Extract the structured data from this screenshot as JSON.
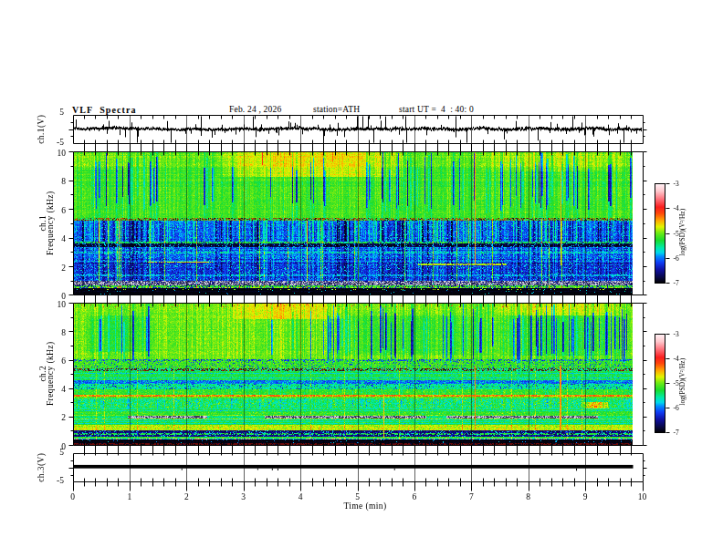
{
  "header": {
    "title": "VLF  Spectra",
    "date": "Feb. 24 , 2026",
    "station": "station=ATH",
    "start_ut": "start UT =  4  : 40: 0"
  },
  "axes": {
    "x_label": "Time (min)",
    "x_ticks": [
      "0",
      "1",
      "2",
      "3",
      "4",
      "5",
      "6",
      "7",
      "8",
      "9",
      "10"
    ],
    "wave_y_ticks": [
      "5",
      "-5"
    ],
    "spec_y_ticks": [
      "10",
      "8",
      "6",
      "4",
      "2",
      "0"
    ],
    "ch3_y_ticks": [
      "5",
      "-5"
    ],
    "ch1_wave_label": "ch.1(V)",
    "ch1_spec_label_line1": "ch.1",
    "ch1_spec_label_line2": "Frequency (kHz)",
    "ch2_spec_label_line1": "ch.2",
    "ch2_spec_label_line2": "Frequency (kHz)",
    "ch3_label": "ch.3(V)"
  },
  "colorbar": {
    "label": "log(PSD)(V²/Hz)",
    "ticks": [
      "-3",
      "-4",
      "-5",
      "-6",
      "-7"
    ],
    "vmin": -7,
    "vmax": -3,
    "stops": [
      [
        0.0,
        2,
        2,
        10
      ],
      [
        0.05,
        8,
        8,
        70
      ],
      [
        0.125,
        15,
        15,
        160
      ],
      [
        0.2,
        15,
        60,
        245
      ],
      [
        0.262,
        0,
        140,
        255
      ],
      [
        0.3,
        0,
        215,
        235
      ],
      [
        0.35,
        0,
        235,
        170
      ],
      [
        0.425,
        25,
        220,
        45
      ],
      [
        0.5,
        110,
        235,
        20
      ],
      [
        0.562,
        225,
        245,
        0
      ],
      [
        0.625,
        255,
        170,
        0
      ],
      [
        0.7,
        255,
        70,
        10
      ],
      [
        0.762,
        250,
        30,
        30
      ],
      [
        0.85,
        255,
        120,
        130
      ],
      [
        0.925,
        255,
        200,
        205
      ],
      [
        1.0,
        255,
        242,
        246
      ]
    ]
  },
  "chart_data": [
    {
      "id": "ch1-waveform",
      "type": "line",
      "ylabel": "ch.1(V)",
      "ylim": [
        -5,
        5
      ],
      "xlim_min": [
        0,
        10
      ],
      "description": "broadband noise trace near 0 V with impulsive spikes",
      "noise_amp": 1.0,
      "spike_prob": 0.1,
      "big_spike_prob": 0.022,
      "seed": 101
    },
    {
      "id": "ch1-spectrogram",
      "type": "heatmap",
      "ylabel": "Frequency (kHz)",
      "ylim": [
        0,
        10
      ],
      "xlim_min": [
        0,
        10
      ],
      "zlabel": "log(PSD)(V²/Hz)",
      "zlim": [
        -7,
        -3
      ],
      "seed": 777,
      "rowsig": 0.07,
      "bands": [
        {
          "f0": 9.0,
          "f1": 10.01,
          "v": -5.1,
          "sig": 0.18,
          "stripe": "hi",
          "gain": 1.0
        },
        {
          "f0": 5.4,
          "f1": 9.0,
          "v": -5.2,
          "sig": 0.17,
          "stripe": "hi",
          "gain": 1.0
        },
        {
          "f0": 5.2,
          "f1": 5.4,
          "v": -5.35,
          "sig": 0.3,
          "stripe": "hi",
          "gain": 0.5,
          "mixP": 0.5,
          "mix": [
            [
              0.5,
              150,
              70,
              10
            ],
            [
              0.3,
              30,
              30,
              20
            ],
            [
              0.2,
              200,
              110,
              0
            ]
          ]
        },
        {
          "f0": 3.7,
          "f1": 5.2,
          "v": -6.1,
          "sig": 0.28,
          "stripe": "lo",
          "gain": 1.05,
          "spkP": 0.08,
          "spkV": -5.65,
          "rowGain": 2.0
        },
        {
          "f0": 3.55,
          "f1": 3.7,
          "v": -5.4,
          "sig": 0.25,
          "stripe": "lo",
          "gain": 0.4,
          "spkP": 0.2,
          "spkV": -6.5
        },
        {
          "f0": 3.3,
          "f1": 3.55,
          "v": -6.85,
          "sig": 0.15,
          "stripe": "lo",
          "gain": 0.3,
          "spkP": 0.13,
          "spkV": -5.9
        },
        {
          "f0": 2.3,
          "f1": 3.3,
          "v": -6.15,
          "sig": 0.28,
          "stripe": "lo",
          "gain": 0.6,
          "spkP": 0.12,
          "spkV": -5.7,
          "rowGain": 2.0
        },
        {
          "f0": 0.95,
          "f1": 2.3,
          "v": -6.3,
          "sig": 0.28,
          "stripe": "lo",
          "gain": 0.55,
          "spkP": 0.1,
          "spkV": -5.75,
          "rowGain": 2.0
        },
        {
          "f0": 0.6,
          "f1": 0.95,
          "v": -6.6,
          "sig": 0.25,
          "mixP": 0.8,
          "mix": [
            [
              0.42,
              60,
              60,
              95
            ],
            [
              0.34,
              190,
              188,
              205
            ],
            [
              0.14,
              120,
              125,
              175
            ],
            [
              0.1,
              225,
              222,
              232
            ]
          ]
        },
        {
          "f0": 0.5,
          "f1": 0.6,
          "v": -5.2,
          "sig": 0.3,
          "spkP": 0.25,
          "spkV": -6.6
        },
        {
          "f0": 0.4,
          "f1": 0.5,
          "v": -4.95,
          "sig": 0.35,
          "spkP": 0.3,
          "spkV": -6.3
        },
        {
          "f0": 0.0,
          "f1": 0.4,
          "v": -7.0,
          "sig": 0.08,
          "spkP": 0.02,
          "spkV": -5.8
        }
      ],
      "hlines": [
        {
          "f0": 2.2,
          "f1": 2.32,
          "t0": 1.3,
          "t1": 2.45,
          "v": -4.7,
          "sig": 0.25,
          "dash": 0.15
        },
        {
          "f0": 2.05,
          "f1": 2.15,
          "t0": 6.05,
          "t1": 7.6,
          "v": -4.85,
          "sig": 0.2,
          "dash": 0.15
        },
        {
          "f0": 2.9,
          "f1": 3.0,
          "v": -5.65,
          "sig": 0.3,
          "dash": 0.35
        },
        {
          "f0": 1.28,
          "f1": 1.38,
          "v": -5.8,
          "sig": 0.25,
          "dash": 0.35
        },
        {
          "f0": 0.28,
          "f1": 0.34,
          "v": -4.9,
          "sig": 0.3,
          "dash": 0.9
        }
      ],
      "warm": [
        {
          "t0": 2.6,
          "t1": 5.8,
          "f0": 8.3,
          "f1": 10.01,
          "dv": 0.4
        },
        {
          "t0": 7.2,
          "t1": 9.7,
          "f0": 8.7,
          "f1": 10.01,
          "dv": 0.22
        },
        {
          "t0": 0.0,
          "t1": 1.1,
          "f0": 8.8,
          "f1": 10.01,
          "dv": 0.1
        }
      ],
      "events": [
        {
          "t": 7.05,
          "f0": 2.05,
          "f1": 10.01,
          "v": -4.45,
          "w": 1.4
        },
        {
          "t": 8.55,
          "f0": 2.05,
          "f1": 10.01,
          "v": -4.55,
          "w": 1.0
        },
        {
          "t": 3.32,
          "f0": 9.1,
          "f1": 10.01,
          "v": -4.1,
          "w": 1.6
        },
        {
          "t": 4.55,
          "f0": 9.3,
          "f1": 10.01,
          "v": -4.3,
          "w": 1.2
        }
      ],
      "sferics": {
        "n": 26,
        "f0": 0.45,
        "f1": 5.4,
        "dv": 1.0,
        "seed": 55
      },
      "stripes": {
        "hi": {
          "sig": 0.17,
          "pDark": 0.06,
          "dark": [
            0.85,
            1.4
          ],
          "pBright": 0.2,
          "bright": [
            0.08,
            0.22
          ],
          "boost": [
            {
              "t0": 0.15,
              "t1": 1.45,
              "p": 0.17
            },
            {
              "t0": 5.4,
              "t1": 9.8,
              "p": 0.2
            }
          ]
        },
        "lo": {
          "sig": 0.22,
          "pDark": 0.09,
          "dark": [
            0.35,
            0.8
          ],
          "pBright": 0.12,
          "bright": [
            0.35,
            0.6
          ],
          "boost": [
            {
              "t0": 4.3,
              "t1": 9.8,
              "p": 0.14
            }
          ]
        }
      }
    },
    {
      "id": "ch2-spectrogram",
      "type": "heatmap",
      "ylabel": "Frequency (kHz)",
      "ylim": [
        0,
        10
      ],
      "xlim_min": [
        0,
        10
      ],
      "zlabel": "log(PSD)(V²/Hz)",
      "zlim": [
        -7,
        -3
      ],
      "seed": 4242,
      "rowsig": 0.06,
      "bands": [
        {
          "f0": 6.05,
          "f1": 10.01,
          "v": -5.05,
          "sig": 0.18,
          "stripe": "hi",
          "gain": 1.0
        },
        {
          "f0": 5.4,
          "f1": 6.05,
          "v": -5.2,
          "sig": 0.26,
          "stripe": "hi",
          "gain": 0.5,
          "spkP": 0.1,
          "spkV": -6.2
        },
        {
          "f0": 5.25,
          "f1": 5.4,
          "v": -5.5,
          "sig": 0.3,
          "mixP": 0.45,
          "mix": [
            [
              0.5,
              120,
              20,
              10
            ],
            [
              0.3,
              25,
              25,
              20
            ],
            [
              0.2,
              170,
              60,
              0
            ]
          ]
        },
        {
          "f0": 4.6,
          "f1": 5.25,
          "v": -5.35,
          "sig": 0.28,
          "stripe": "hi",
          "gain": 0.35,
          "rows": {
            "period": 0.17,
            "dv": -0.45
          }
        },
        {
          "f0": 4.3,
          "f1": 4.6,
          "v": -6.1,
          "sig": 0.22,
          "spkP": 0.2,
          "spkV": -5.6
        },
        {
          "f0": 3.95,
          "f1": 4.3,
          "v": -5.55,
          "sig": 0.3,
          "spkP": 0.1,
          "spkV": -6.3
        },
        {
          "f0": 3.56,
          "f1": 3.95,
          "v": -5.25,
          "sig": 0.25,
          "stripe": "lo",
          "gain": 0.35
        },
        {
          "f0": 3.42,
          "f1": 3.56,
          "v": -4.25,
          "sig": 0.2,
          "spkP": 0.3,
          "spkV": -4.75
        },
        {
          "f0": 3.28,
          "f1": 3.42,
          "v": -5.1,
          "sig": 0.25
        },
        {
          "f0": 2.55,
          "f1": 3.28,
          "v": -5.5,
          "sig": 0.27,
          "stripe": "lo",
          "gain": 0.5,
          "spkP": 0.16,
          "spkV": -5.05
        },
        {
          "f0": 2.12,
          "f1": 2.55,
          "v": -5.3,
          "sig": 0.24,
          "rows": {
            "period": 0.15,
            "dv": -0.4
          }
        },
        {
          "f0": 1.84,
          "f1": 2.06,
          "v": -5.45,
          "sig": 0.26,
          "gray": [
            [
              0.95,
              2.35
            ],
            [
              3.35,
              6.2
            ],
            [
              6.55,
              9.2
            ]
          ],
          "mix": [
            [
              0.42,
              60,
              60,
              95
            ],
            [
              0.34,
              190,
              188,
              205
            ],
            [
              0.14,
              120,
              125,
              175
            ],
            [
              0.1,
              225,
              222,
              232
            ]
          ]
        },
        {
          "f0": 1.38,
          "f1": 1.8,
          "v": -5.3,
          "sig": 0.24,
          "rows": {
            "period": 0.13,
            "dv": -0.45
          }
        },
        {
          "f0": 0.98,
          "f1": 1.38,
          "v": -4.85,
          "sig": 0.24,
          "spkP": 0.06,
          "spkV": -4.45
        },
        {
          "f0": 0.58,
          "f1": 0.98,
          "v": -6.6,
          "sig": 0.25,
          "spkP": 0.12,
          "spkV": -5.8
        },
        {
          "f0": 0.44,
          "f1": 0.58,
          "v": -5.25,
          "sig": 0.3
        },
        {
          "f0": 0.36,
          "f1": 0.44,
          "v": -5.85,
          "sig": 0.2,
          "spkP": 0.3,
          "spkV": -3.4
        },
        {
          "f0": 0.12,
          "f1": 0.36,
          "v": -7.0,
          "sig": 0.08,
          "spkP": 0.03,
          "spkV": -5.9
        },
        {
          "f0": 0.0,
          "f1": 0.12,
          "v": -6.9,
          "sig": 0.1,
          "mixP": 0.85,
          "mix": [
            [
              0.7,
              105,
              10,
              10
            ],
            [
              0.3,
              18,
              4,
              4
            ]
          ]
        }
      ],
      "hlines": [
        {
          "f0": 0.7,
          "f1": 0.78,
          "v": -5.35,
          "sig": 0.3,
          "dash": 0.4
        },
        {
          "f0": 5.92,
          "f1": 6.05,
          "v": -6.2,
          "sig": 0.3,
          "dash": 0.65
        },
        {
          "f0": 2.2,
          "f1": 2.28,
          "v": -5.15,
          "sig": 0.25,
          "dash": 0.35
        }
      ],
      "warm": [
        {
          "t0": 2.8,
          "t1": 4.7,
          "f0": 8.9,
          "f1": 10.01,
          "dv": 0.32
        },
        {
          "t0": 7.4,
          "t1": 9.7,
          "f0": 9.2,
          "f1": 10.01,
          "dv": 0.25
        },
        {
          "t0": 0.2,
          "t1": 1.35,
          "f0": 6.6,
          "f1": 9.2,
          "dv": -0.22
        },
        {
          "t0": 4.5,
          "t1": 7.25,
          "f0": 6.4,
          "f1": 9.2,
          "dv": -0.2
        },
        {
          "t0": 8.95,
          "t1": 9.4,
          "f0": 2.55,
          "f1": 3.0,
          "dv": 0.8
        },
        {
          "t0": 7.5,
          "t1": 9.7,
          "f0": 6.3,
          "f1": 9.2,
          "dv": -0.22
        }
      ],
      "events": [
        {
          "t": 7.05,
          "f0": 1.0,
          "f1": 5.6,
          "v": -4.4,
          "w": 1.6
        },
        {
          "t": 8.55,
          "f0": 1.0,
          "f1": 5.6,
          "v": -4.45,
          "w": 1.4
        },
        {
          "t": 5.45,
          "f0": 0.5,
          "f1": 3.6,
          "v": -4.6,
          "w": 1.2
        }
      ],
      "sferics": {
        "n": 12,
        "f0": 0.4,
        "f1": 5.2,
        "dv": 0.4,
        "seed": 77
      },
      "topspecks": {
        "p": 0.02,
        "f0": 9.78,
        "v": -4.0
      },
      "stripes": {
        "hi": {
          "sig": 0.13,
          "pDark": 0.05,
          "dark": [
            0.85,
            1.35
          ],
          "pBright": 0.2,
          "bright": [
            0.08,
            0.22
          ],
          "boost": [
            {
              "t0": 4.4,
              "t1": 7.3,
              "p": 0.26
            },
            {
              "t0": 7.6,
              "t1": 9.7,
              "p": 0.33
            },
            {
              "t0": 0.25,
              "t1": 1.35,
              "p": 0.18
            }
          ]
        },
        "lo": {
          "sig": 0.16,
          "pDark": 0.09,
          "dark": [
            0.35,
            0.8
          ],
          "pBright": 0.1,
          "bright": [
            0.35,
            0.55
          ],
          "boost": []
        }
      }
    },
    {
      "id": "ch3-waveform",
      "type": "line",
      "ylabel": "ch.3(V)",
      "ylim": [
        -5,
        5
      ],
      "xlim_min": [
        0,
        10
      ],
      "description": "flat saturated trace at ~+0.4 V",
      "flat_value": 0.4,
      "thickness_px": 3.8,
      "seed": 303
    }
  ]
}
